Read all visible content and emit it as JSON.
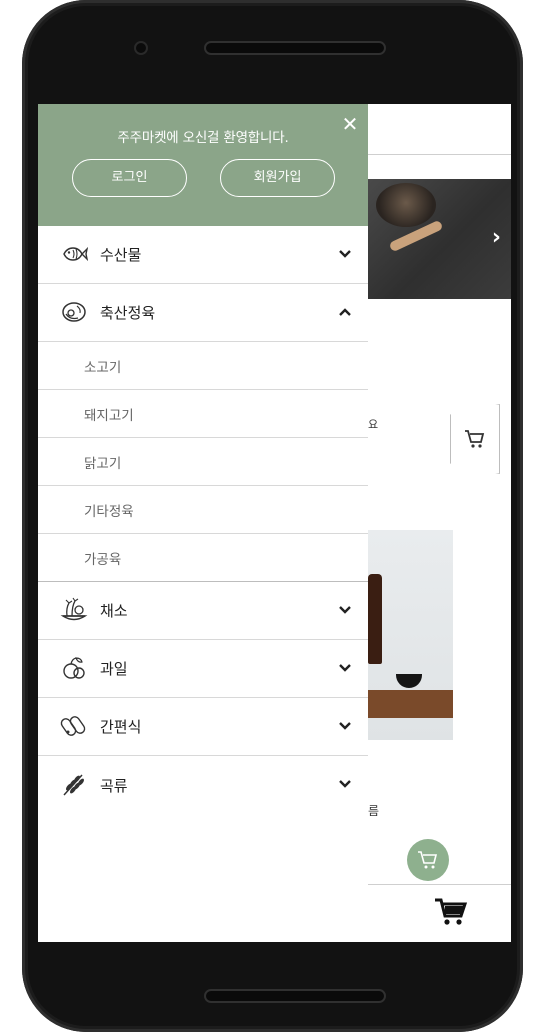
{
  "drawer": {
    "welcome_text": "주주마켓에 오신걸 환영합니다.",
    "close_icon": "close-icon",
    "login_label": "로그인",
    "signup_label": "회원가입",
    "header_color": "#8ba589"
  },
  "menu": {
    "categories": [
      {
        "label": "수산물",
        "icon": "fish-icon",
        "expanded": false
      },
      {
        "label": "축산정육",
        "icon": "meat-icon",
        "expanded": true,
        "subitems": [
          "소고기",
          "돼지고기",
          "닭고기",
          "기타정육",
          "가공육"
        ]
      },
      {
        "label": "채소",
        "icon": "vegetable-icon",
        "expanded": false
      },
      {
        "label": "과일",
        "icon": "fruit-icon",
        "expanded": false
      },
      {
        "label": "간편식",
        "icon": "snack-icon",
        "expanded": false
      },
      {
        "label": "곡류",
        "icon": "grain-icon",
        "expanded": false
      }
    ]
  },
  "background_page": {
    "partial_text_1": "요",
    "partial_text_2": "름",
    "fab_color": "#8eb08e"
  }
}
